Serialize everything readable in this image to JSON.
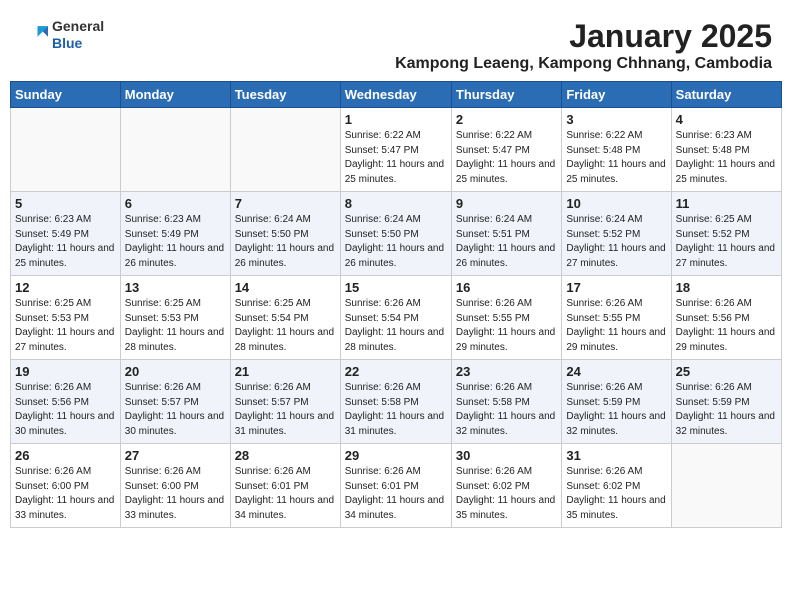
{
  "header": {
    "logo_general": "General",
    "logo_blue": "Blue",
    "month": "January 2025",
    "location": "Kampong Leaeng, Kampong Chhnang, Cambodia"
  },
  "weekdays": [
    "Sunday",
    "Monday",
    "Tuesday",
    "Wednesday",
    "Thursday",
    "Friday",
    "Saturday"
  ],
  "weeks": [
    [
      {
        "day": "",
        "sunrise": "",
        "sunset": "",
        "daylight": ""
      },
      {
        "day": "",
        "sunrise": "",
        "sunset": "",
        "daylight": ""
      },
      {
        "day": "",
        "sunrise": "",
        "sunset": "",
        "daylight": ""
      },
      {
        "day": "1",
        "sunrise": "Sunrise: 6:22 AM",
        "sunset": "Sunset: 5:47 PM",
        "daylight": "Daylight: 11 hours and 25 minutes."
      },
      {
        "day": "2",
        "sunrise": "Sunrise: 6:22 AM",
        "sunset": "Sunset: 5:47 PM",
        "daylight": "Daylight: 11 hours and 25 minutes."
      },
      {
        "day": "3",
        "sunrise": "Sunrise: 6:22 AM",
        "sunset": "Sunset: 5:48 PM",
        "daylight": "Daylight: 11 hours and 25 minutes."
      },
      {
        "day": "4",
        "sunrise": "Sunrise: 6:23 AM",
        "sunset": "Sunset: 5:48 PM",
        "daylight": "Daylight: 11 hours and 25 minutes."
      }
    ],
    [
      {
        "day": "5",
        "sunrise": "Sunrise: 6:23 AM",
        "sunset": "Sunset: 5:49 PM",
        "daylight": "Daylight: 11 hours and 25 minutes."
      },
      {
        "day": "6",
        "sunrise": "Sunrise: 6:23 AM",
        "sunset": "Sunset: 5:49 PM",
        "daylight": "Daylight: 11 hours and 26 minutes."
      },
      {
        "day": "7",
        "sunrise": "Sunrise: 6:24 AM",
        "sunset": "Sunset: 5:50 PM",
        "daylight": "Daylight: 11 hours and 26 minutes."
      },
      {
        "day": "8",
        "sunrise": "Sunrise: 6:24 AM",
        "sunset": "Sunset: 5:50 PM",
        "daylight": "Daylight: 11 hours and 26 minutes."
      },
      {
        "day": "9",
        "sunrise": "Sunrise: 6:24 AM",
        "sunset": "Sunset: 5:51 PM",
        "daylight": "Daylight: 11 hours and 26 minutes."
      },
      {
        "day": "10",
        "sunrise": "Sunrise: 6:24 AM",
        "sunset": "Sunset: 5:52 PM",
        "daylight": "Daylight: 11 hours and 27 minutes."
      },
      {
        "day": "11",
        "sunrise": "Sunrise: 6:25 AM",
        "sunset": "Sunset: 5:52 PM",
        "daylight": "Daylight: 11 hours and 27 minutes."
      }
    ],
    [
      {
        "day": "12",
        "sunrise": "Sunrise: 6:25 AM",
        "sunset": "Sunset: 5:53 PM",
        "daylight": "Daylight: 11 hours and 27 minutes."
      },
      {
        "day": "13",
        "sunrise": "Sunrise: 6:25 AM",
        "sunset": "Sunset: 5:53 PM",
        "daylight": "Daylight: 11 hours and 28 minutes."
      },
      {
        "day": "14",
        "sunrise": "Sunrise: 6:25 AM",
        "sunset": "Sunset: 5:54 PM",
        "daylight": "Daylight: 11 hours and 28 minutes."
      },
      {
        "day": "15",
        "sunrise": "Sunrise: 6:26 AM",
        "sunset": "Sunset: 5:54 PM",
        "daylight": "Daylight: 11 hours and 28 minutes."
      },
      {
        "day": "16",
        "sunrise": "Sunrise: 6:26 AM",
        "sunset": "Sunset: 5:55 PM",
        "daylight": "Daylight: 11 hours and 29 minutes."
      },
      {
        "day": "17",
        "sunrise": "Sunrise: 6:26 AM",
        "sunset": "Sunset: 5:55 PM",
        "daylight": "Daylight: 11 hours and 29 minutes."
      },
      {
        "day": "18",
        "sunrise": "Sunrise: 6:26 AM",
        "sunset": "Sunset: 5:56 PM",
        "daylight": "Daylight: 11 hours and 29 minutes."
      }
    ],
    [
      {
        "day": "19",
        "sunrise": "Sunrise: 6:26 AM",
        "sunset": "Sunset: 5:56 PM",
        "daylight": "Daylight: 11 hours and 30 minutes."
      },
      {
        "day": "20",
        "sunrise": "Sunrise: 6:26 AM",
        "sunset": "Sunset: 5:57 PM",
        "daylight": "Daylight: 11 hours and 30 minutes."
      },
      {
        "day": "21",
        "sunrise": "Sunrise: 6:26 AM",
        "sunset": "Sunset: 5:57 PM",
        "daylight": "Daylight: 11 hours and 31 minutes."
      },
      {
        "day": "22",
        "sunrise": "Sunrise: 6:26 AM",
        "sunset": "Sunset: 5:58 PM",
        "daylight": "Daylight: 11 hours and 31 minutes."
      },
      {
        "day": "23",
        "sunrise": "Sunrise: 6:26 AM",
        "sunset": "Sunset: 5:58 PM",
        "daylight": "Daylight: 11 hours and 32 minutes."
      },
      {
        "day": "24",
        "sunrise": "Sunrise: 6:26 AM",
        "sunset": "Sunset: 5:59 PM",
        "daylight": "Daylight: 11 hours and 32 minutes."
      },
      {
        "day": "25",
        "sunrise": "Sunrise: 6:26 AM",
        "sunset": "Sunset: 5:59 PM",
        "daylight": "Daylight: 11 hours and 32 minutes."
      }
    ],
    [
      {
        "day": "26",
        "sunrise": "Sunrise: 6:26 AM",
        "sunset": "Sunset: 6:00 PM",
        "daylight": "Daylight: 11 hours and 33 minutes."
      },
      {
        "day": "27",
        "sunrise": "Sunrise: 6:26 AM",
        "sunset": "Sunset: 6:00 PM",
        "daylight": "Daylight: 11 hours and 33 minutes."
      },
      {
        "day": "28",
        "sunrise": "Sunrise: 6:26 AM",
        "sunset": "Sunset: 6:01 PM",
        "daylight": "Daylight: 11 hours and 34 minutes."
      },
      {
        "day": "29",
        "sunrise": "Sunrise: 6:26 AM",
        "sunset": "Sunset: 6:01 PM",
        "daylight": "Daylight: 11 hours and 34 minutes."
      },
      {
        "day": "30",
        "sunrise": "Sunrise: 6:26 AM",
        "sunset": "Sunset: 6:02 PM",
        "daylight": "Daylight: 11 hours and 35 minutes."
      },
      {
        "day": "31",
        "sunrise": "Sunrise: 6:26 AM",
        "sunset": "Sunset: 6:02 PM",
        "daylight": "Daylight: 11 hours and 35 minutes."
      },
      {
        "day": "",
        "sunrise": "",
        "sunset": "",
        "daylight": ""
      }
    ]
  ]
}
